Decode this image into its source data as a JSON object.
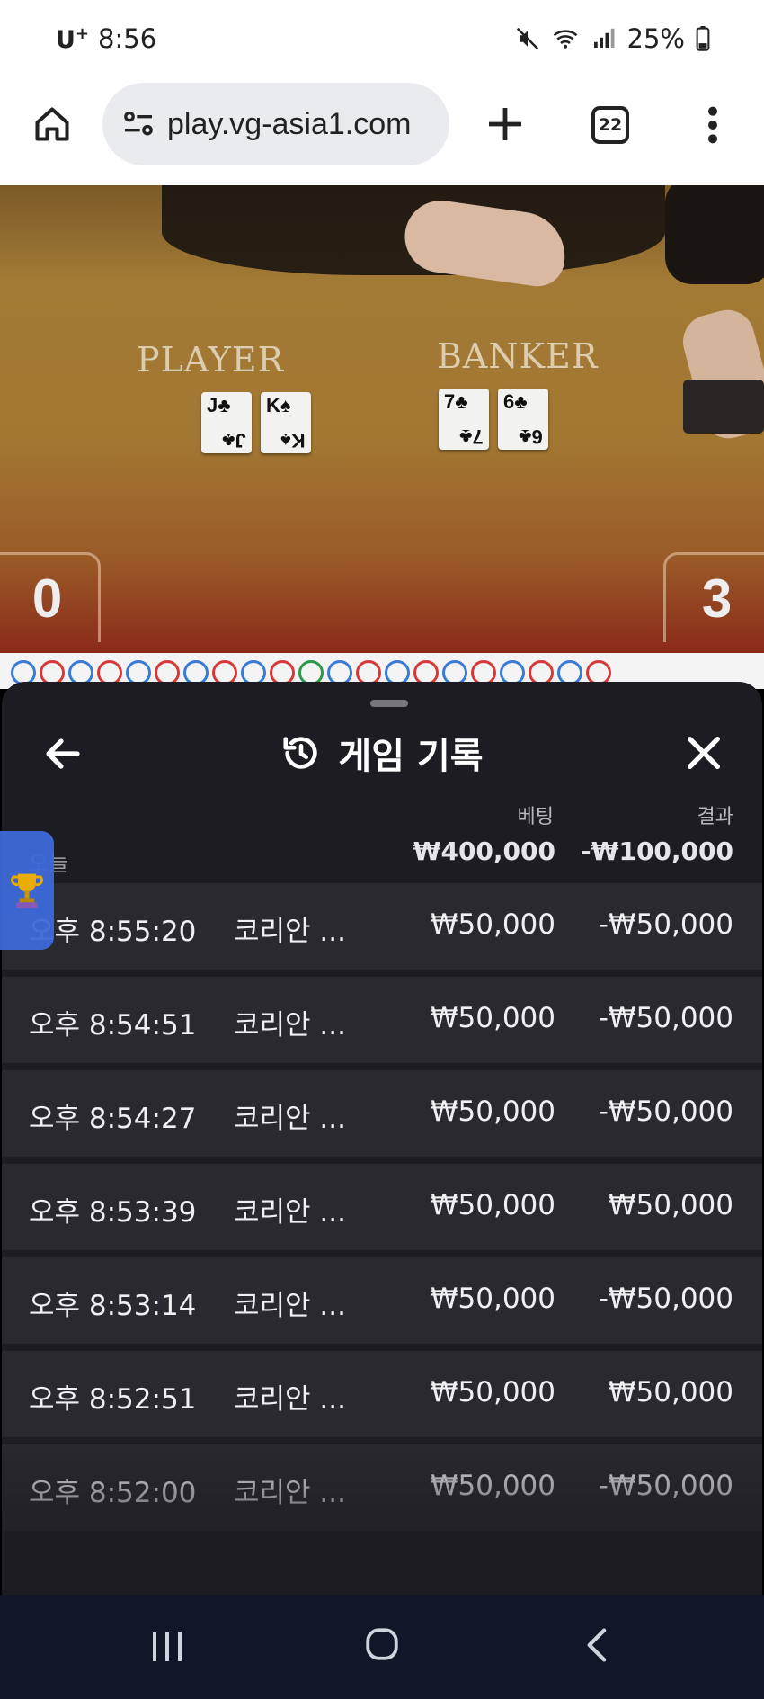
{
  "status_bar": {
    "carrier": "U",
    "carrier_plus": "+",
    "time": "8:56",
    "battery": "25%"
  },
  "browser": {
    "url": "play.vg-asia1.com",
    "tab_count": "22"
  },
  "game": {
    "player_label": "PLAYER",
    "banker_label": "BANKER",
    "player_cards": [
      {
        "rank": "J",
        "suit": "♣"
      },
      {
        "rank": "K",
        "suit": "♠"
      }
    ],
    "banker_cards": [
      {
        "rank": "7",
        "suit": "♣"
      },
      {
        "rank": "6",
        "suit": "♣"
      }
    ],
    "player_score": "0",
    "banker_score": "3"
  },
  "history_sheet": {
    "title": "게임 기록",
    "column_bet": "베팅",
    "column_result": "결과",
    "today_label": "오늘",
    "total_bet": "₩400,000",
    "total_result": "-₩100,000",
    "rows": [
      {
        "time": "오후 8:55:20",
        "game": "코리안 ...",
        "bet": "₩50,000",
        "result": "-₩50,000"
      },
      {
        "time": "오후 8:54:51",
        "game": "코리안 ...",
        "bet": "₩50,000",
        "result": "-₩50,000"
      },
      {
        "time": "오후 8:54:27",
        "game": "코리안 ...",
        "bet": "₩50,000",
        "result": "-₩50,000"
      },
      {
        "time": "오후 8:53:39",
        "game": "코리안 ...",
        "bet": "₩50,000",
        "result": "₩50,000"
      },
      {
        "time": "오후 8:53:14",
        "game": "코리안 ...",
        "bet": "₩50,000",
        "result": "-₩50,000"
      },
      {
        "time": "오후 8:52:51",
        "game": "코리안 ...",
        "bet": "₩50,000",
        "result": "₩50,000"
      },
      {
        "time": "오후 8:52:00",
        "game": "코리안 ...",
        "bet": "₩50,000",
        "result": "-₩50,000"
      }
    ]
  },
  "icons": {
    "home": "home-icon",
    "site_settings": "tune-icon",
    "new_tab": "plus-icon",
    "more": "more-vert-icon",
    "back": "arrow-left-icon",
    "history": "history-icon",
    "close": "close-icon",
    "trophy": "trophy-icon"
  },
  "colors": {
    "sheet_bg": "#1d1c22",
    "row_bg": "#2a2930",
    "trophy_tab": "#3e6ad8",
    "nav_bar": "#111628"
  }
}
